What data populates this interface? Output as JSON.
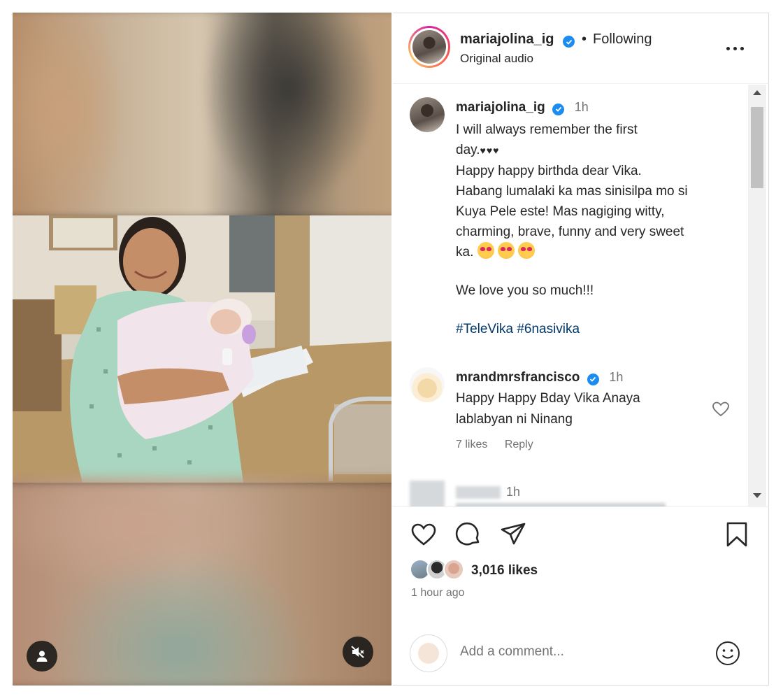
{
  "post": {
    "username": "mariajolina_ig",
    "dot": "•",
    "following_label": "Following",
    "audio_label": "Original audio"
  },
  "caption": {
    "username": "mariajolina_ig",
    "time": "1h",
    "line1": "I will always remember the first",
    "line2": "day.",
    "hearts": "♥♥♥",
    "line3": "Happy happy birthda dear Vika.",
    "line4": "Habang lumalaki ka mas sinisilpa mo si",
    "line5": "Kuya Pele este! Mas nagiging witty,",
    "line6": "charming, brave, funny and very sweet",
    "line7": "ka.",
    "line8": "We love you so much!!!",
    "hashtags": "#TeleVika #6nasivika"
  },
  "reply": {
    "username": "mrandmrsfrancisco",
    "time": "1h",
    "line1": "Happy Happy Bday Vika Anaya",
    "line2": "lablabyan ni Ninang",
    "likes": "7 likes",
    "reply_label": "Reply"
  },
  "next_comment": {
    "time": "1h"
  },
  "footer": {
    "likes": "3,016 likes",
    "post_time": "1 hour ago",
    "comment_placeholder": "Add a comment..."
  },
  "icons": {
    "like": "heart-outline-icon",
    "comment": "speech-bubble-icon",
    "share": "paper-plane-icon",
    "save": "bookmark-icon",
    "mute": "speaker-muted-icon",
    "user_tag": "person-icon",
    "emoji": "smiley-icon"
  },
  "colors": {
    "verified": "#1d8cf0",
    "hashtag": "#00376b",
    "secondary_text": "#737373"
  }
}
